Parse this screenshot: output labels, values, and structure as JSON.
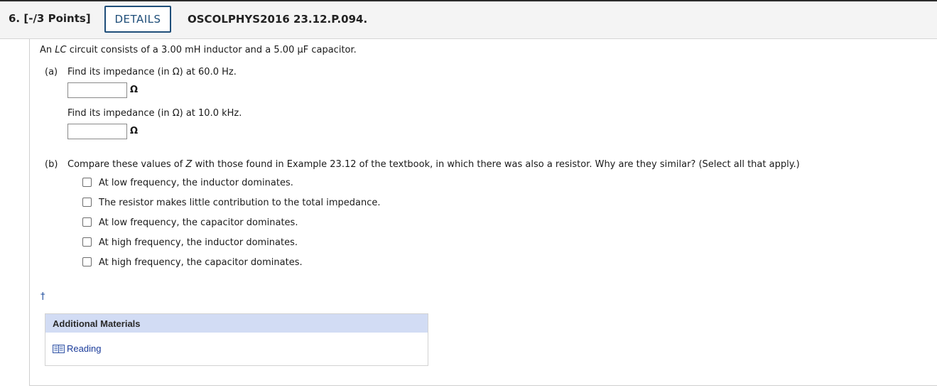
{
  "header": {
    "question_number": "6.  [-/3 Points]",
    "details_label": "DETAILS",
    "problem_id": "OSCOLPHYS2016 23.12.P.094."
  },
  "question": {
    "intro_prefix": "An ",
    "intro_italic": "LC",
    "intro_suffix": " circuit consists of a 3.00 mH inductor and a 5.00 μF capacitor.",
    "part_a": {
      "label": "(a)",
      "prompt_1": "Find its impedance (in Ω) at 60.0 Hz.",
      "answer_1": "",
      "unit_1": "Ω",
      "prompt_2": "Find its impedance (in Ω) at 10.0 kHz.",
      "answer_2": "",
      "unit_2": "Ω"
    },
    "part_b": {
      "label": "(b)",
      "prompt_prefix": "Compare these values of ",
      "prompt_italic": "Z",
      "prompt_suffix": " with those found in Example 23.12 of the textbook, in which there was also a resistor. Why are they similar? (Select all that apply.)",
      "options": [
        "At low frequency, the inductor dominates.",
        "The resistor makes little contribution to the total impedance.",
        "At low frequency, the capacitor dominates.",
        "At high frequency, the inductor dominates.",
        "At high frequency, the capacitor dominates."
      ]
    },
    "dagger": "†"
  },
  "additional_materials": {
    "title": "Additional Materials",
    "links": [
      {
        "label": "Reading",
        "icon": "book-icon"
      }
    ]
  },
  "colors": {
    "details_border": "#1f4e79",
    "materials_header_bg": "#d2dcf4",
    "link_color": "#1a3b9a"
  }
}
